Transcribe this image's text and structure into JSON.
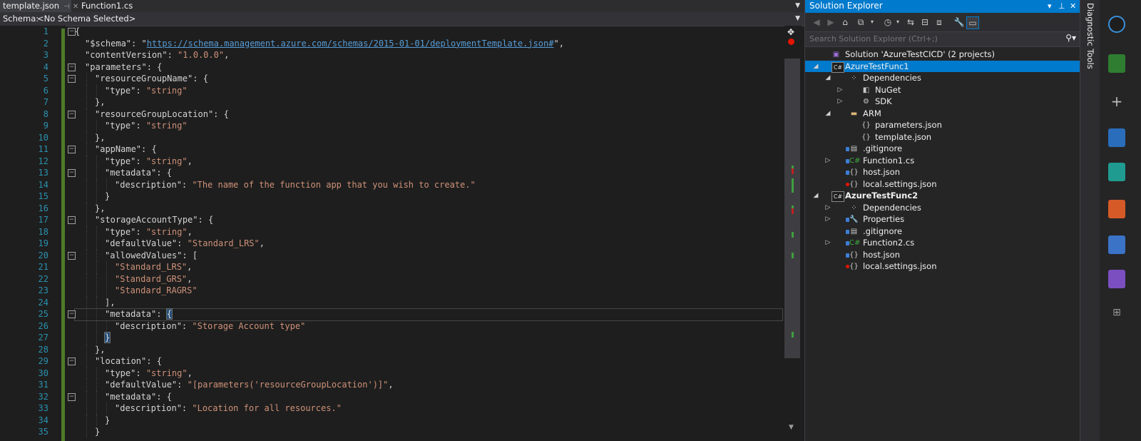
{
  "tabs": [
    {
      "label": "template.json",
      "active": true
    },
    {
      "label": "Function1.cs",
      "active": false
    }
  ],
  "schema_bar": {
    "label": "Schema:",
    "value": "<No Schema Selected>"
  },
  "editor": {
    "line_numbers": [
      "1",
      "2",
      "3",
      "4",
      "5",
      "6",
      "7",
      "8",
      "9",
      "10",
      "11",
      "12",
      "13",
      "14",
      "15",
      "16",
      "17",
      "18",
      "19",
      "20",
      "21",
      "22",
      "23",
      "24",
      "25",
      "26",
      "27",
      "28",
      "29",
      "30",
      "31",
      "32",
      "33",
      "34",
      "35"
    ],
    "current_line": "25",
    "lines": [
      {
        "indent": 0,
        "parts": [
          [
            "p",
            "{"
          ]
        ]
      },
      {
        "indent": 1,
        "parts": [
          [
            "k",
            "\"$schema\""
          ],
          [
            "p",
            ": \""
          ],
          [
            "u",
            "https://schema.management.azure.com/schemas/2015-01-01/deploymentTemplate.json#"
          ],
          [
            "p",
            "\","
          ]
        ]
      },
      {
        "indent": 1,
        "parts": [
          [
            "k",
            "\"contentVersion\""
          ],
          [
            "p",
            ": "
          ],
          [
            "s",
            "\"1.0.0.0\""
          ],
          [
            "p",
            ","
          ]
        ]
      },
      {
        "indent": 1,
        "parts": [
          [
            "k",
            "\"parameters\""
          ],
          [
            "p",
            ": {"
          ]
        ]
      },
      {
        "indent": 2,
        "parts": [
          [
            "k",
            "\"resourceGroupName\""
          ],
          [
            "p",
            ": {"
          ]
        ]
      },
      {
        "indent": 3,
        "parts": [
          [
            "k",
            "\"type\""
          ],
          [
            "p",
            ": "
          ],
          [
            "s",
            "\"string\""
          ]
        ]
      },
      {
        "indent": 2,
        "parts": [
          [
            "p",
            "},"
          ]
        ]
      },
      {
        "indent": 2,
        "parts": [
          [
            "k",
            "\"resourceGroupLocation\""
          ],
          [
            "p",
            ": {"
          ]
        ]
      },
      {
        "indent": 3,
        "parts": [
          [
            "k",
            "\"type\""
          ],
          [
            "p",
            ": "
          ],
          [
            "s",
            "\"string\""
          ]
        ]
      },
      {
        "indent": 2,
        "parts": [
          [
            "p",
            "},"
          ]
        ]
      },
      {
        "indent": 2,
        "parts": [
          [
            "k",
            "\"appName\""
          ],
          [
            "p",
            ": {"
          ]
        ]
      },
      {
        "indent": 3,
        "parts": [
          [
            "k",
            "\"type\""
          ],
          [
            "p",
            ": "
          ],
          [
            "s",
            "\"string\""
          ],
          [
            "p",
            ","
          ]
        ]
      },
      {
        "indent": 3,
        "parts": [
          [
            "k",
            "\"metadata\""
          ],
          [
            "p",
            ": {"
          ]
        ]
      },
      {
        "indent": 4,
        "parts": [
          [
            "k",
            "\"description\""
          ],
          [
            "p",
            ": "
          ],
          [
            "s",
            "\"The name of the function app that you wish to create.\""
          ]
        ]
      },
      {
        "indent": 3,
        "parts": [
          [
            "p",
            "}"
          ]
        ]
      },
      {
        "indent": 2,
        "parts": [
          [
            "p",
            "},"
          ]
        ]
      },
      {
        "indent": 2,
        "parts": [
          [
            "k",
            "\"storageAccountType\""
          ],
          [
            "p",
            ": {"
          ]
        ]
      },
      {
        "indent": 3,
        "parts": [
          [
            "k",
            "\"type\""
          ],
          [
            "p",
            ": "
          ],
          [
            "s",
            "\"string\""
          ],
          [
            "p",
            ","
          ]
        ]
      },
      {
        "indent": 3,
        "parts": [
          [
            "k",
            "\"defaultValue\""
          ],
          [
            "p",
            ": "
          ],
          [
            "s",
            "\"Standard_LRS\""
          ],
          [
            "p",
            ","
          ]
        ]
      },
      {
        "indent": 3,
        "parts": [
          [
            "k",
            "\"allowedValues\""
          ],
          [
            "p",
            ": ["
          ]
        ]
      },
      {
        "indent": 4,
        "parts": [
          [
            "s",
            "\"Standard_LRS\""
          ],
          [
            "p",
            ","
          ]
        ]
      },
      {
        "indent": 4,
        "parts": [
          [
            "s",
            "\"Standard_GRS\""
          ],
          [
            "p",
            ","
          ]
        ]
      },
      {
        "indent": 4,
        "parts": [
          [
            "s",
            "\"Standard_RAGRS\""
          ]
        ]
      },
      {
        "indent": 3,
        "parts": [
          [
            "p",
            "],"
          ]
        ]
      },
      {
        "indent": 3,
        "parts": [
          [
            "k",
            "\"metadata\""
          ],
          [
            "p",
            ": "
          ],
          [
            "br",
            "{"
          ]
        ]
      },
      {
        "indent": 4,
        "parts": [
          [
            "k",
            "\"description\""
          ],
          [
            "p",
            ": "
          ],
          [
            "s",
            "\"Storage Account type\""
          ]
        ]
      },
      {
        "indent": 3,
        "parts": [
          [
            "br",
            "}"
          ]
        ]
      },
      {
        "indent": 2,
        "parts": [
          [
            "p",
            "},"
          ]
        ]
      },
      {
        "indent": 2,
        "parts": [
          [
            "k",
            "\"location\""
          ],
          [
            "p",
            ": {"
          ]
        ]
      },
      {
        "indent": 3,
        "parts": [
          [
            "k",
            "\"type\""
          ],
          [
            "p",
            ": "
          ],
          [
            "s",
            "\"string\""
          ],
          [
            "p",
            ","
          ]
        ]
      },
      {
        "indent": 3,
        "parts": [
          [
            "k",
            "\"defaultValue\""
          ],
          [
            "p",
            ": "
          ],
          [
            "s",
            "\"[parameters('resourceGroupLocation')]\""
          ],
          [
            "p",
            ","
          ]
        ]
      },
      {
        "indent": 3,
        "parts": [
          [
            "k",
            "\"metadata\""
          ],
          [
            "p",
            ": {"
          ]
        ]
      },
      {
        "indent": 4,
        "parts": [
          [
            "k",
            "\"description\""
          ],
          [
            "p",
            ": "
          ],
          [
            "s",
            "\"Location for all resources.\""
          ]
        ]
      },
      {
        "indent": 3,
        "parts": [
          [
            "p",
            "}"
          ]
        ]
      },
      {
        "indent": 2,
        "parts": [
          [
            "p",
            "}"
          ]
        ]
      }
    ],
    "fold_lines": [
      "1",
      "4",
      "5",
      "8",
      "11",
      "13",
      "17",
      "20",
      "25",
      "29",
      "32"
    ]
  },
  "solution_explorer": {
    "title": "Solution Explorer",
    "search_placeholder": "Search Solution Explorer (Ctrl+;)",
    "items": [
      {
        "label": "Solution 'AzureTestCICD' (2 projects)",
        "icon": "solution-icon",
        "level": 0,
        "toggle": "",
        "bold": false,
        "selected": false
      },
      {
        "label": "AzureTestFunc1",
        "icon": "csharp-project-icon",
        "level": 0,
        "toggle": "expanded",
        "bold": false,
        "selected": true
      },
      {
        "label": "Dependencies",
        "icon": "dependencies-icon",
        "level": 1,
        "toggle": "expanded",
        "bold": false,
        "selected": false
      },
      {
        "label": "NuGet",
        "icon": "nuget-icon",
        "level": 2,
        "toggle": "collapsed",
        "bold": false,
        "selected": false
      },
      {
        "label": "SDK",
        "icon": "sdk-icon",
        "level": 2,
        "toggle": "collapsed",
        "bold": false,
        "selected": false
      },
      {
        "label": "ARM",
        "icon": "folder-icon",
        "level": 1,
        "toggle": "expanded",
        "bold": false,
        "selected": false
      },
      {
        "label": "parameters.json",
        "icon": "json-file-icon",
        "level": 2,
        "toggle": "",
        "bold": false,
        "selected": false
      },
      {
        "label": "template.json",
        "icon": "json-file-icon",
        "level": 2,
        "toggle": "",
        "bold": false,
        "selected": false
      },
      {
        "label": ".gitignore",
        "icon": "file-icon",
        "level": 1,
        "toggle": "",
        "bold": false,
        "selected": false
      },
      {
        "label": "Function1.cs",
        "icon": "csharp-file-icon",
        "level": 1,
        "toggle": "collapsed",
        "bold": false,
        "selected": false
      },
      {
        "label": "host.json",
        "icon": "json-file-icon",
        "level": 1,
        "toggle": "",
        "bold": false,
        "selected": false
      },
      {
        "label": "local.settings.json",
        "icon": "json-file-icon",
        "level": 1,
        "toggle": "",
        "bold": false,
        "selected": false
      },
      {
        "label": "AzureTestFunc2",
        "icon": "csharp-project-icon",
        "level": 0,
        "toggle": "expanded",
        "bold": true,
        "selected": false
      },
      {
        "label": "Dependencies",
        "icon": "dependencies-icon",
        "level": 1,
        "toggle": "collapsed",
        "bold": false,
        "selected": false
      },
      {
        "label": "Properties",
        "icon": "wrench-icon",
        "level": 1,
        "toggle": "collapsed",
        "bold": false,
        "selected": false
      },
      {
        "label": ".gitignore",
        "icon": "file-icon",
        "level": 1,
        "toggle": "",
        "bold": false,
        "selected": false
      },
      {
        "label": "Function2.cs",
        "icon": "csharp-file-icon",
        "level": 1,
        "toggle": "collapsed",
        "bold": false,
        "selected": false
      },
      {
        "label": "host.json",
        "icon": "json-file-icon",
        "level": 1,
        "toggle": "",
        "bold": false,
        "selected": false
      },
      {
        "label": "local.settings.json",
        "icon": "json-file-icon",
        "level": 1,
        "toggle": "",
        "bold": false,
        "selected": false
      }
    ]
  },
  "side_tab": {
    "label": "Diagnostic Tools"
  },
  "colors": {
    "accent": "#007acc",
    "editor_bg": "#1e1e1e",
    "string": "#ce9178",
    "line_number": "#2b91af",
    "link": "#569cd6",
    "change_bar": "#4d7a2a"
  }
}
